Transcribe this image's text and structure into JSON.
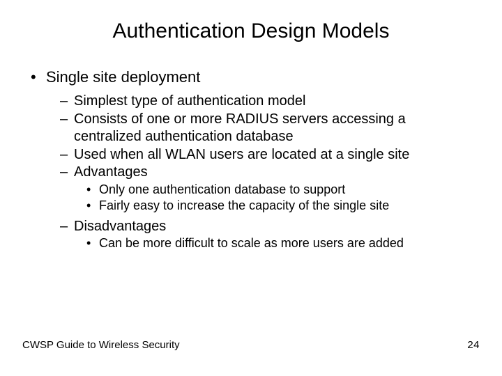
{
  "title": "Authentication Design Models",
  "l1": {
    "item1": "Single site deployment"
  },
  "l2": {
    "a": "Simplest type of authentication model",
    "b_line1": "Consists of one or more RADIUS servers accessing a",
    "b_line2": "centralized authentication database",
    "c": "Used when all WLAN users are located at a single site",
    "d": "Advantages",
    "e": "Disadvantages"
  },
  "l3": {
    "adv1": "Only one authentication database to support",
    "adv2": "Fairly easy to increase the capacity of the single site",
    "dis1": "Can be more difficult to scale as more users are added"
  },
  "footer": {
    "left": "CWSP Guide to Wireless Security",
    "page": "24"
  }
}
